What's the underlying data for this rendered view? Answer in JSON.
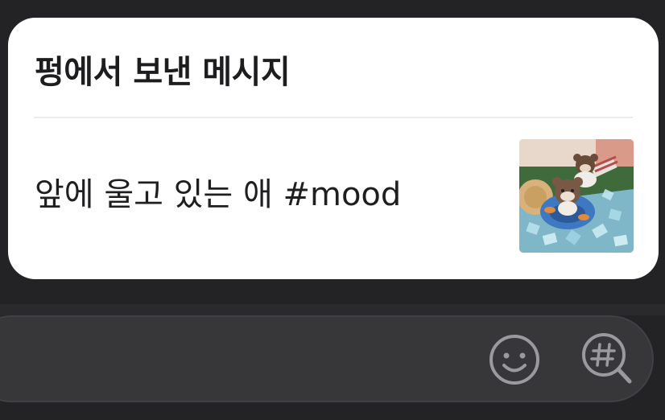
{
  "card": {
    "title": "펑에서 보낸 메시지",
    "message": "앞에 울고 있는 애 #mood",
    "thumbnail_icon": "photo-thumbnail"
  },
  "composer": {
    "emoji_icon": "smiley-icon",
    "hashtag_search_icon": "hashtag-search-icon"
  },
  "colors": {
    "background": "#232325",
    "card": "#ffffff",
    "input_bar": "#37373a",
    "icon": "#9a9a9e"
  }
}
